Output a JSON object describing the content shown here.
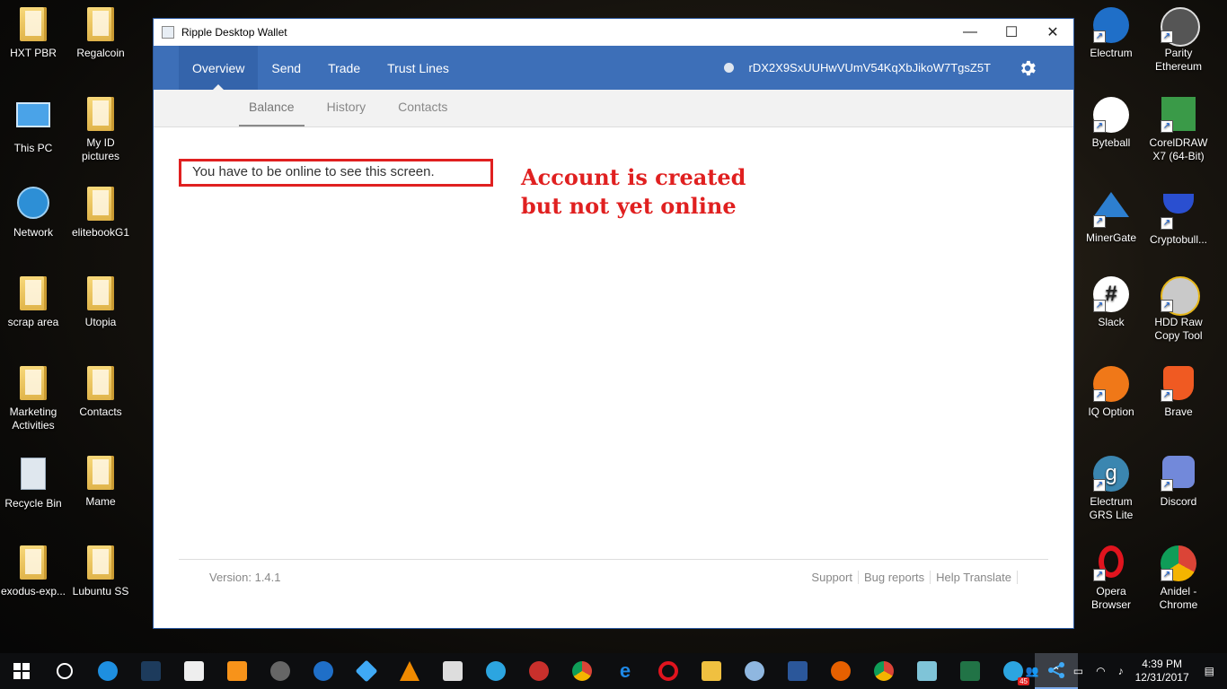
{
  "desktop": {
    "left_col1": [
      "HXT PBR",
      "This PC",
      "Network",
      "scrap area",
      "Marketing Activities",
      "Recycle Bin",
      "exodus-exp..."
    ],
    "left_col2": [
      "Regalcoin",
      "My ID pictures",
      "elitebookG1",
      "Utopia",
      "Contacts",
      "Mame",
      "Lubuntu SS"
    ],
    "right_col1": [
      "Electrum",
      "Byteball",
      "MinerGate",
      "Slack",
      "IQ Option",
      "Electrum GRS Lite",
      "Opera Browser"
    ],
    "right_col2": [
      "Parity Ethereum",
      "CorelDRAW X7 (64-Bit)",
      "Cryptobull...",
      "HDD Raw Copy Tool",
      "Brave",
      "Discord",
      "Anidel - Chrome"
    ]
  },
  "window": {
    "title": "Ripple Desktop Wallet",
    "controls": {
      "minimize": "—",
      "maximize": "☐",
      "close": "✕"
    },
    "nav": {
      "items": [
        "Overview",
        "Send",
        "Trade",
        "Trust Lines"
      ],
      "active": "Overview",
      "address": "rDX2X9SxUUHwVUmV54KqXbJikoW7TgsZ5T"
    },
    "subnav": {
      "items": [
        "Balance",
        "History",
        "Contacts"
      ],
      "active": "Balance"
    },
    "message": "You have to be online to see this screen.",
    "annotation_line1": "Account is created",
    "annotation_line2": "but not yet online",
    "footer": {
      "version": "Version: 1.4.1",
      "links": [
        "Support",
        "Bug reports",
        "Help Translate"
      ]
    }
  },
  "taskbar": {
    "time": "4:39 PM",
    "date": "12/31/2017",
    "badge": "45",
    "colors": {
      "accent": "#3d6fb8",
      "alert": "#e02020"
    }
  }
}
